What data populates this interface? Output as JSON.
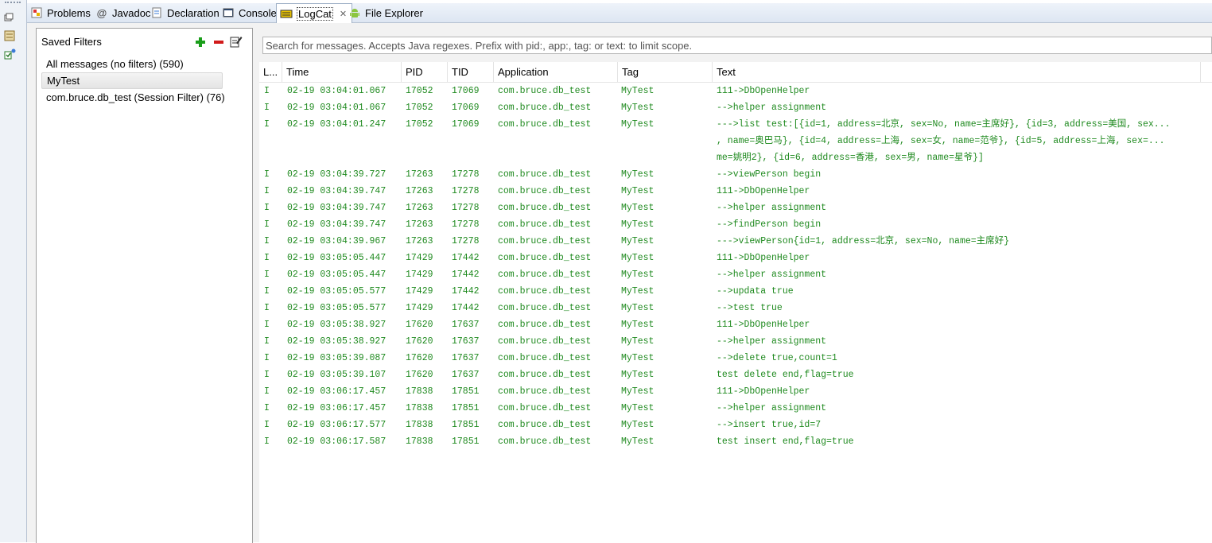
{
  "tabs": [
    {
      "label": "Problems",
      "icon": "problems-icon"
    },
    {
      "label": "Javadoc",
      "icon": "javadoc-icon"
    },
    {
      "label": "Declaration",
      "icon": "declaration-icon"
    },
    {
      "label": "Console",
      "icon": "console-icon"
    },
    {
      "label": "LogCat",
      "icon": "logcat-icon",
      "active": true
    },
    {
      "label": "File Explorer",
      "icon": "android-icon"
    }
  ],
  "filters": {
    "title": "Saved Filters",
    "items": [
      {
        "label": "All messages (no filters) (590)"
      },
      {
        "label": "MyTest",
        "selected": true
      },
      {
        "label": "com.bruce.db_test (Session Filter) (76)"
      }
    ]
  },
  "search": {
    "placeholder": "Search for messages. Accepts Java regexes. Prefix with pid:, app:, tag: or text: to limit scope."
  },
  "columns": [
    "L...",
    "Time",
    "PID",
    "TID",
    "Application",
    "Tag",
    "Text"
  ],
  "colors": {
    "log_text": "#1f8a1f",
    "add": "#1a9e1a",
    "remove": "#d11a1a"
  },
  "log": [
    {
      "level": "I",
      "time": "02-19 03:04:01.067",
      "pid": "17052",
      "tid": "17069",
      "app": "com.bruce.db_test",
      "tag": "MyTest",
      "text": [
        "111->DbOpenHelper"
      ]
    },
    {
      "level": "I",
      "time": "02-19 03:04:01.067",
      "pid": "17052",
      "tid": "17069",
      "app": "com.bruce.db_test",
      "tag": "MyTest",
      "text": [
        "-->helper assignment"
      ]
    },
    {
      "level": "I",
      "time": "02-19 03:04:01.247",
      "pid": "17052",
      "tid": "17069",
      "app": "com.bruce.db_test",
      "tag": "MyTest",
      "text": [
        "--->list test:[{id=1, address=北京, sex=No, name=主席好}, {id=3, address=美国, sex...",
        ", name=奥巴马}, {id=4, address=上海, sex=女, name=范爷}, {id=5, address=上海, sex=...",
        "me=姚明2}, {id=6, address=香港, sex=男, name=星爷}]"
      ]
    },
    {
      "level": "I",
      "time": "02-19 03:04:39.727",
      "pid": "17263",
      "tid": "17278",
      "app": "com.bruce.db_test",
      "tag": "MyTest",
      "text": [
        "-->viewPerson begin"
      ]
    },
    {
      "level": "I",
      "time": "02-19 03:04:39.747",
      "pid": "17263",
      "tid": "17278",
      "app": "com.bruce.db_test",
      "tag": "MyTest",
      "text": [
        "111->DbOpenHelper"
      ]
    },
    {
      "level": "I",
      "time": "02-19 03:04:39.747",
      "pid": "17263",
      "tid": "17278",
      "app": "com.bruce.db_test",
      "tag": "MyTest",
      "text": [
        "-->helper assignment"
      ]
    },
    {
      "level": "I",
      "time": "02-19 03:04:39.747",
      "pid": "17263",
      "tid": "17278",
      "app": "com.bruce.db_test",
      "tag": "MyTest",
      "text": [
        "-->findPerson begin"
      ]
    },
    {
      "level": "I",
      "time": "02-19 03:04:39.967",
      "pid": "17263",
      "tid": "17278",
      "app": "com.bruce.db_test",
      "tag": "MyTest",
      "text": [
        "--->viewPerson{id=1, address=北京, sex=No, name=主席好}"
      ]
    },
    {
      "level": "I",
      "time": "02-19 03:05:05.447",
      "pid": "17429",
      "tid": "17442",
      "app": "com.bruce.db_test",
      "tag": "MyTest",
      "text": [
        "111->DbOpenHelper"
      ]
    },
    {
      "level": "I",
      "time": "02-19 03:05:05.447",
      "pid": "17429",
      "tid": "17442",
      "app": "com.bruce.db_test",
      "tag": "MyTest",
      "text": [
        "-->helper assignment"
      ]
    },
    {
      "level": "I",
      "time": "02-19 03:05:05.577",
      "pid": "17429",
      "tid": "17442",
      "app": "com.bruce.db_test",
      "tag": "MyTest",
      "text": [
        "-->updata true"
      ]
    },
    {
      "level": "I",
      "time": "02-19 03:05:05.577",
      "pid": "17429",
      "tid": "17442",
      "app": "com.bruce.db_test",
      "tag": "MyTest",
      "text": [
        "-->test true"
      ]
    },
    {
      "level": "I",
      "time": "02-19 03:05:38.927",
      "pid": "17620",
      "tid": "17637",
      "app": "com.bruce.db_test",
      "tag": "MyTest",
      "text": [
        "111->DbOpenHelper"
      ]
    },
    {
      "level": "I",
      "time": "02-19 03:05:38.927",
      "pid": "17620",
      "tid": "17637",
      "app": "com.bruce.db_test",
      "tag": "MyTest",
      "text": [
        "-->helper assignment"
      ]
    },
    {
      "level": "I",
      "time": "02-19 03:05:39.087",
      "pid": "17620",
      "tid": "17637",
      "app": "com.bruce.db_test",
      "tag": "MyTest",
      "text": [
        "-->delete true,count=1"
      ]
    },
    {
      "level": "I",
      "time": "02-19 03:05:39.107",
      "pid": "17620",
      "tid": "17637",
      "app": "com.bruce.db_test",
      "tag": "MyTest",
      "text": [
        "test delete end,flag=true"
      ]
    },
    {
      "level": "I",
      "time": "02-19 03:06:17.457",
      "pid": "17838",
      "tid": "17851",
      "app": "com.bruce.db_test",
      "tag": "MyTest",
      "text": [
        "111->DbOpenHelper"
      ]
    },
    {
      "level": "I",
      "time": "02-19 03:06:17.457",
      "pid": "17838",
      "tid": "17851",
      "app": "com.bruce.db_test",
      "tag": "MyTest",
      "text": [
        "-->helper assignment"
      ]
    },
    {
      "level": "I",
      "time": "02-19 03:06:17.577",
      "pid": "17838",
      "tid": "17851",
      "app": "com.bruce.db_test",
      "tag": "MyTest",
      "text": [
        "-->insert true,id=7"
      ]
    },
    {
      "level": "I",
      "time": "02-19 03:06:17.587",
      "pid": "17838",
      "tid": "17851",
      "app": "com.bruce.db_test",
      "tag": "MyTest",
      "text": [
        "test insert end,flag=true"
      ]
    }
  ]
}
